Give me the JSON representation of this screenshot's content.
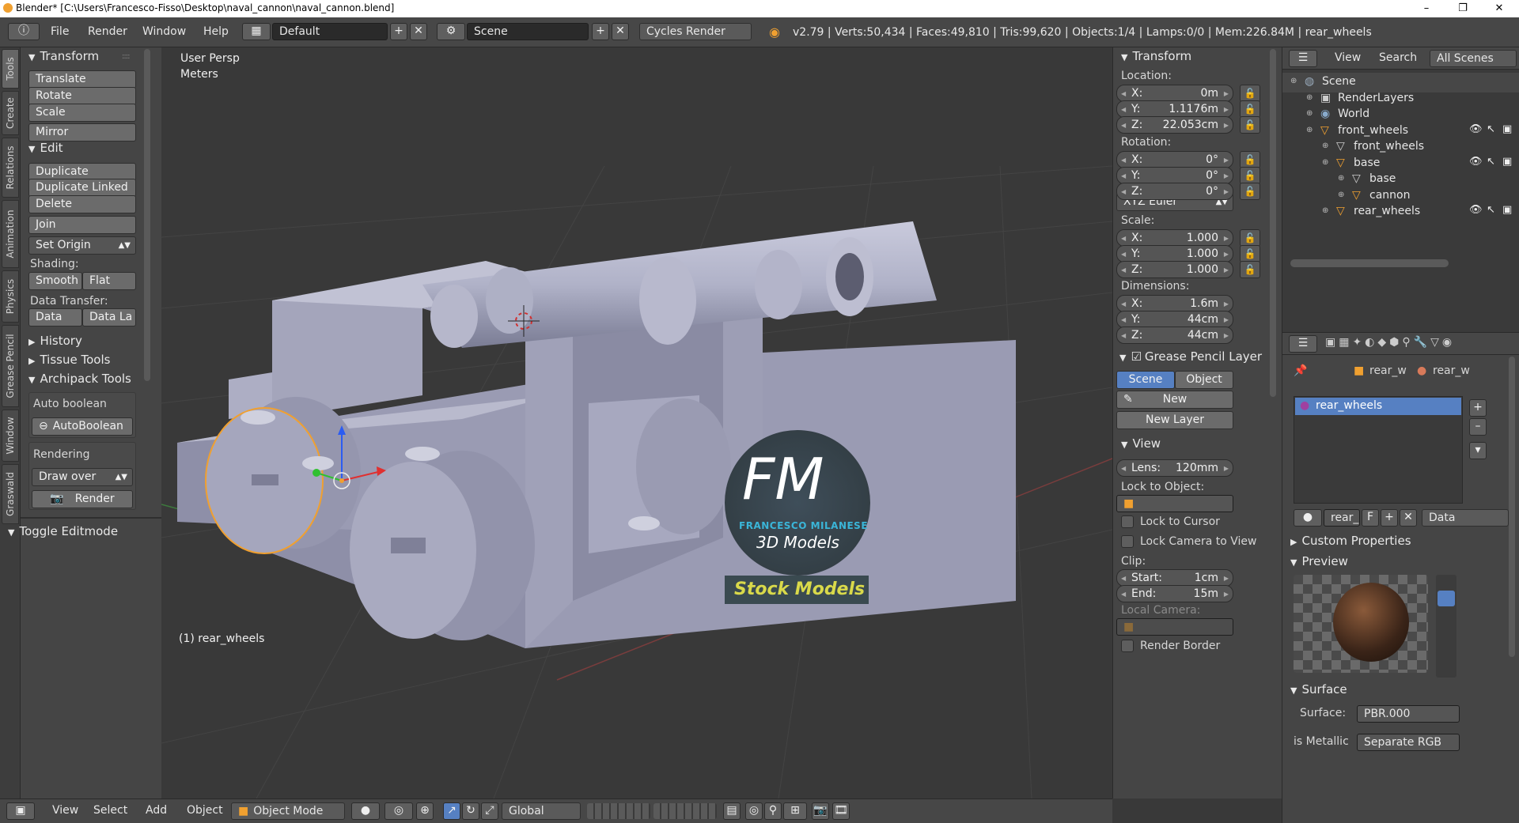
{
  "window": {
    "title": "Blender* [C:\\Users\\Francesco-Fisso\\Desktop\\naval_cannon\\naval_cannon.blend]",
    "min": "–",
    "max": "❐",
    "close": "✕"
  },
  "topbar": {
    "menus": [
      "File",
      "Render",
      "Window",
      "Help"
    ],
    "layout": "Default",
    "scene": "Scene",
    "engine": "Cycles Render",
    "info": "v2.79 | Verts:50,434 | Faces:49,810 | Tris:99,620 | Objects:1/4 | Lamps:0/0 | Mem:226.84M | rear_wheels"
  },
  "toolshelf": {
    "tabs": [
      "Tools",
      "Create",
      "Relations",
      "Animation",
      "Physics",
      "Grease Pencil",
      "Window",
      "Graswald"
    ],
    "transform": {
      "header": "Transform",
      "buttons": [
        "Translate",
        "Rotate",
        "Scale",
        "Mirror"
      ]
    },
    "edit": {
      "header": "Edit",
      "buttons": [
        "Duplicate",
        "Duplicate Linked",
        "Delete",
        "Join",
        "Set Origin"
      ],
      "shading_label": "Shading:",
      "smooth": "Smooth",
      "flat": "Flat",
      "data_transfer_label": "Data Transfer:",
      "data": "Data",
      "data_layout": "Data La"
    },
    "history": "History",
    "tissue": "Tissue Tools",
    "archipack": {
      "header": "Archipack Tools",
      "auto_boolean_label": "Auto boolean",
      "auto_boolean_btn": "AutoBoolean",
      "rendering_label": "Rendering",
      "draw_over": "Draw over",
      "render": "Render"
    },
    "toggle_editmode": "Toggle Editmode"
  },
  "viewport": {
    "view_name": "User Persp",
    "units": "Meters",
    "selected": "(1) rear_wheels",
    "watermark": {
      "initials": "FM",
      "name": "FRANCESCO MILANESE",
      "subtitle": "3D Models",
      "stock": "Stock Models"
    }
  },
  "npanel": {
    "transform": "Transform",
    "location_label": "Location:",
    "location": [
      {
        "k": "X:",
        "v": "0m"
      },
      {
        "k": "Y:",
        "v": "1.1176m"
      },
      {
        "k": "Z:",
        "v": "22.053cm"
      }
    ],
    "rotation_label": "Rotation:",
    "rotation": [
      {
        "k": "X:",
        "v": "0°"
      },
      {
        "k": "Y:",
        "v": "0°"
      },
      {
        "k": "Z:",
        "v": "0°"
      }
    ],
    "rotation_mode": "XYZ Euler",
    "scale_label": "Scale:",
    "scale": [
      {
        "k": "X:",
        "v": "1.000"
      },
      {
        "k": "Y:",
        "v": "1.000"
      },
      {
        "k": "Z:",
        "v": "1.000"
      }
    ],
    "dimensions_label": "Dimensions:",
    "dimensions": [
      {
        "k": "X:",
        "v": "1.6m"
      },
      {
        "k": "Y:",
        "v": "44cm"
      },
      {
        "k": "Z:",
        "v": "44cm"
      }
    ],
    "grease_pencil": "Grease Pencil Layer",
    "gp_scene": "Scene",
    "gp_object": "Object",
    "gp_new": "New",
    "gp_new_layer": "New Layer",
    "view": "View",
    "lens": {
      "k": "Lens:",
      "v": "120mm"
    },
    "lock_to_object": "Lock to Object:",
    "lock_to_cursor": "Lock to Cursor",
    "lock_camera": "Lock Camera to View",
    "clip_label": "Clip:",
    "clip_start": {
      "k": "Start:",
      "v": "1cm"
    },
    "clip_end": {
      "k": "End:",
      "v": "15m"
    },
    "local_camera": "Local Camera:",
    "render_border": "Render Border"
  },
  "outliner": {
    "view": "View",
    "search": "Search",
    "filter": "All Scenes",
    "rows": [
      {
        "label": "Scene",
        "indent": 0
      },
      {
        "label": "RenderLayers",
        "indent": 1
      },
      {
        "label": "World",
        "indent": 1
      },
      {
        "label": "front_wheels",
        "indent": 1
      },
      {
        "label": "front_wheels",
        "indent": 2
      },
      {
        "label": "base",
        "indent": 2
      },
      {
        "label": "base",
        "indent": 3
      },
      {
        "label": "cannon",
        "indent": 3
      },
      {
        "label": "rear_wheels",
        "indent": 2
      }
    ]
  },
  "properties": {
    "breadcrumb_obj": "rear_w",
    "breadcrumb_mat": "rear_w",
    "material_slot": "rear_wheels",
    "mat_field": "rear_",
    "fake_user": "F",
    "link": "Data",
    "custom_props": "Custom Properties",
    "preview": "Preview",
    "surface_header": "Surface",
    "surface_label": "Surface:",
    "surface_value": "PBR.000",
    "is_metallic": "is Metallic",
    "separate_rgb": "Separate RGB"
  },
  "bottombar": {
    "menus": [
      "View",
      "Select",
      "Add",
      "Object"
    ],
    "mode": "Object Mode",
    "orientation": "Global"
  },
  "colors": {
    "accent": "#5680c2",
    "selected_orange": "#f0a030",
    "panel": "#454545",
    "viewport": "#393939"
  }
}
